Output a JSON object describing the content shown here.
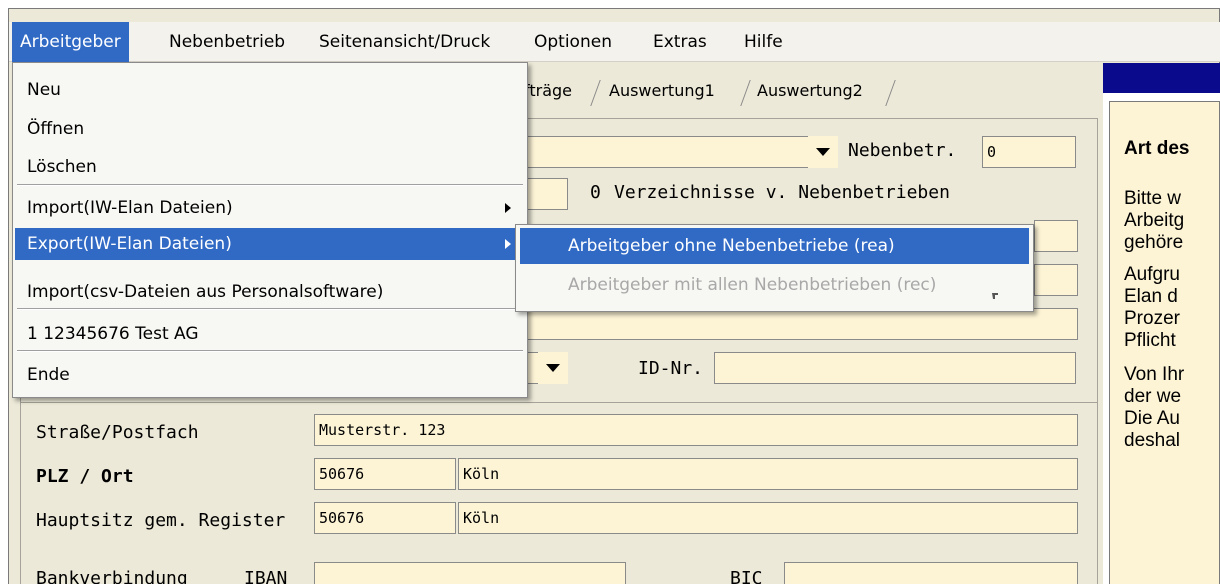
{
  "menubar": {
    "items": [
      "Arbeitgeber",
      "Nebenbetrieb",
      "Seitenansicht/Druck",
      "Optionen",
      "Extras",
      "Hilfe"
    ]
  },
  "tabs": [
    "fträge",
    "Auswertung1",
    "Auswertung2"
  ],
  "form": {
    "nebenbetr_label": "Nebenbetr.",
    "nebenbetr_value": "0",
    "verz_count": "0",
    "verz_label": "Verzeichnisse v. Nebenbetrieben",
    "idnr_label": "ID-Nr.",
    "strasse_label": "Straße/Postfach",
    "strasse_value": "Musterstr. 123",
    "plz_ort_label": "PLZ  / Ort",
    "plz_value": "50676",
    "ort_value": "Köln",
    "hauptsitz_label": "Hauptsitz gem. Register",
    "hauptsitz_plz": "50676",
    "hauptsitz_ort": "Köln",
    "bank_label": "Bankverbindung",
    "iban_label": "IBAN",
    "bic_label": "BIC"
  },
  "rightpanel": {
    "heading": "Art des",
    "lines": [
      "Bitte w",
      "Arbeitg",
      "gehöre",
      "Aufgru",
      "Elan d",
      "Prozer",
      "Pflicht",
      "Von Ihr",
      "der we",
      "Die Au",
      "deshal"
    ]
  },
  "menu": {
    "neu": "Neu",
    "oeffnen": "Öffnen",
    "loeschen": "Löschen",
    "import_iw": "Import(IW-Elan Dateien)",
    "export_iw": "Export(IW-Elan Dateien)",
    "import_csv": "Import(csv-Dateien aus Personalsoftware)",
    "recent": "1 12345676 Test AG",
    "ende": "Ende"
  },
  "submenu": {
    "ohne": "Arbeitgeber ohne Nebenbetriebe (rea)",
    "mit": "Arbeitgeber mit allen Nebenbetrieben (rec)"
  },
  "colors": {
    "highlight": "#316ac5",
    "field_bg": "#fdf4d6",
    "panel_header": "#0a0a8c"
  }
}
